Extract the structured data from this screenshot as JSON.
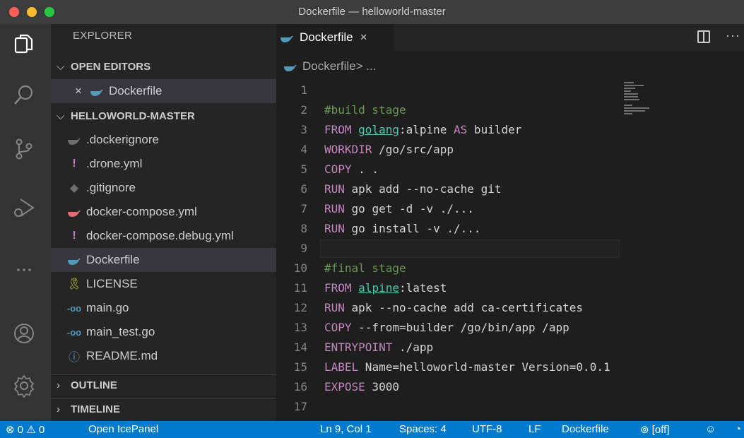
{
  "window": {
    "title": "Dockerfile — helloworld-master"
  },
  "sidebar": {
    "title": "EXPLORER",
    "open_editors": {
      "label": "OPEN EDITORS",
      "items": [
        {
          "label": "Dockerfile"
        }
      ]
    },
    "folder": {
      "label": "HELLOWORLD-MASTER",
      "items": [
        {
          "label": ".dockerignore",
          "icon": "docker-icon"
        },
        {
          "label": ".drone.yml",
          "icon": "yaml-icon"
        },
        {
          "label": ".gitignore",
          "icon": "git-icon"
        },
        {
          "label": "docker-compose.yml",
          "icon": "docker-compose-icon"
        },
        {
          "label": "docker-compose.debug.yml",
          "icon": "yaml-icon"
        },
        {
          "label": "Dockerfile",
          "icon": "docker-icon"
        },
        {
          "label": "LICENSE",
          "icon": "license-icon"
        },
        {
          "label": "main.go",
          "icon": "go-icon"
        },
        {
          "label": "main_test.go",
          "icon": "go-icon"
        },
        {
          "label": "README.md",
          "icon": "info-icon"
        }
      ]
    },
    "outline": {
      "label": "OUTLINE"
    },
    "timeline": {
      "label": "TIMELINE"
    }
  },
  "editor": {
    "tab": {
      "label": "Dockerfile",
      "close": "×"
    },
    "breadcrumb": {
      "file": "Dockerfile",
      "rest": " > ..."
    },
    "current_line": 9,
    "lines": [
      {
        "n": "1",
        "parts": []
      },
      {
        "n": "2",
        "parts": [
          {
            "t": "#build stage",
            "c": "cm"
          }
        ]
      },
      {
        "n": "3",
        "parts": [
          {
            "t": "FROM ",
            "c": "kw"
          },
          {
            "t": "golang",
            "c": "img"
          },
          {
            "t": ":alpine ",
            "c": "val"
          },
          {
            "t": "AS",
            "c": "kw"
          },
          {
            "t": " builder",
            "c": "val"
          }
        ]
      },
      {
        "n": "4",
        "parts": [
          {
            "t": "WORKDIR",
            "c": "kw"
          },
          {
            "t": " /go/src/app",
            "c": "val"
          }
        ]
      },
      {
        "n": "5",
        "parts": [
          {
            "t": "COPY",
            "c": "kw"
          },
          {
            "t": " . .",
            "c": "val"
          }
        ]
      },
      {
        "n": "6",
        "parts": [
          {
            "t": "RUN",
            "c": "kw"
          },
          {
            "t": " apk add --no-cache git",
            "c": "val"
          }
        ]
      },
      {
        "n": "7",
        "parts": [
          {
            "t": "RUN",
            "c": "kw"
          },
          {
            "t": " go get -d -v ./...",
            "c": "val"
          }
        ]
      },
      {
        "n": "8",
        "parts": [
          {
            "t": "RUN",
            "c": "kw"
          },
          {
            "t": " go install -v ./...",
            "c": "val"
          }
        ]
      },
      {
        "n": "9",
        "parts": []
      },
      {
        "n": "10",
        "parts": [
          {
            "t": "#final stage",
            "c": "cm"
          }
        ]
      },
      {
        "n": "11",
        "parts": [
          {
            "t": "FROM ",
            "c": "kw"
          },
          {
            "t": "alpine",
            "c": "img"
          },
          {
            "t": ":latest",
            "c": "val"
          }
        ]
      },
      {
        "n": "12",
        "parts": [
          {
            "t": "RUN",
            "c": "kw"
          },
          {
            "t": " apk --no-cache add ca-certificates",
            "c": "val"
          }
        ]
      },
      {
        "n": "13",
        "parts": [
          {
            "t": "COPY",
            "c": "kw"
          },
          {
            "t": " --from=builder /go/bin/app /app",
            "c": "val"
          }
        ]
      },
      {
        "n": "14",
        "parts": [
          {
            "t": "ENTRYPOINT",
            "c": "kw"
          },
          {
            "t": " ./app",
            "c": "val"
          }
        ]
      },
      {
        "n": "15",
        "parts": [
          {
            "t": "LABEL",
            "c": "kw"
          },
          {
            "t": " Name=helloworld-master Version=0.0.1",
            "c": "val"
          }
        ]
      },
      {
        "n": "16",
        "parts": [
          {
            "t": "EXPOSE",
            "c": "kw"
          },
          {
            "t": " 3000",
            "c": "val"
          }
        ]
      },
      {
        "n": "17",
        "parts": []
      }
    ]
  },
  "statusbar": {
    "errors": "0",
    "warnings": "0",
    "icepanel": "Open IcePanel",
    "position": "Ln 9, Col 1",
    "spaces": "Spaces: 4",
    "encoding": "UTF-8",
    "eol": "LF",
    "language": "Dockerfile",
    "live": "[off]"
  },
  "colors": {
    "accent": "#007acc",
    "docker": "#519aba",
    "yaml": "#c586c0",
    "compose": "#e06c75",
    "go": "#519aba",
    "license": "#cbcb41"
  }
}
